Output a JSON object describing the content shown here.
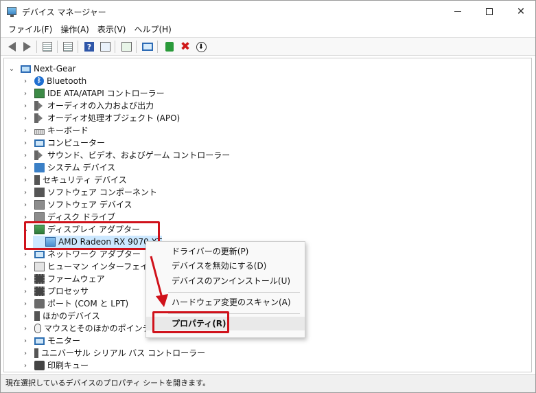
{
  "window": {
    "title": "デバイス マネージャー"
  },
  "menu": [
    "ファイル(F)",
    "操作(A)",
    "表示(V)",
    "ヘルプ(H)"
  ],
  "tree": {
    "root": "Next-Gear",
    "items": [
      {
        "label": "Bluetooth",
        "icon": "bluetooth-icon"
      },
      {
        "label": "IDE ATA/ATAPI コントローラー",
        "icon": "controller-board-icon"
      },
      {
        "label": "オーディオの入力および出力",
        "icon": "speaker-icon"
      },
      {
        "label": "オーディオ処理オブジェクト (APO)",
        "icon": "speaker-icon"
      },
      {
        "label": "キーボード",
        "icon": "keyboard-icon"
      },
      {
        "label": "コンピューター",
        "icon": "computer-icon"
      },
      {
        "label": "サウンド、ビデオ、およびゲーム コントローラー",
        "icon": "speaker-icon"
      },
      {
        "label": "システム デバイス",
        "icon": "folder-icon"
      },
      {
        "label": "セキュリティ デバイス",
        "icon": "security-key-icon"
      },
      {
        "label": "ソフトウェア コンポーネント",
        "icon": "puzzle-icon"
      },
      {
        "label": "ソフトウェア デバイス",
        "icon": "software-device-icon"
      },
      {
        "label": "ディスク ドライブ",
        "icon": "disk-drive-icon"
      },
      {
        "label": "ディスプレイ アダプター",
        "icon": "display-adapter-icon"
      },
      {
        "label": "AMD Radeon RX 9070 XT",
        "icon": "gpu-icon"
      },
      {
        "label": "ネットワーク アダプター",
        "icon": "network-icon"
      },
      {
        "label": "ヒューマン インターフェイス デバイス",
        "icon": "hid-icon"
      },
      {
        "label": "ファームウェア",
        "icon": "firmware-icon"
      },
      {
        "label": "プロセッサ",
        "icon": "processor-icon"
      },
      {
        "label": "ポート (COM と LPT)",
        "icon": "port-icon"
      },
      {
        "label": "ほかのデバイス",
        "icon": "unknown-device-icon"
      },
      {
        "label": "マウスとそのほかのポインティング デバイス",
        "icon": "mouse-icon"
      },
      {
        "label": "モニター",
        "icon": "monitor-icon"
      },
      {
        "label": "ユニバーサル シリアル バス コントローラー",
        "icon": "usb-icon"
      },
      {
        "label": "印刷キュー",
        "icon": "printer-icon"
      }
    ]
  },
  "context_menu": {
    "update_driver": "ドライバーの更新(P)",
    "disable": "デバイスを無効にする(D)",
    "uninstall": "デバイスのアンインストール(U)",
    "scan": "ハードウェア変更のスキャン(A)",
    "properties": "プロパティ(R)"
  },
  "statusbar": {
    "text": "現在選択しているデバイスのプロパティ シートを開きます。"
  },
  "colors": {
    "highlight": "#d0121b",
    "selection": "#cce8ff"
  }
}
